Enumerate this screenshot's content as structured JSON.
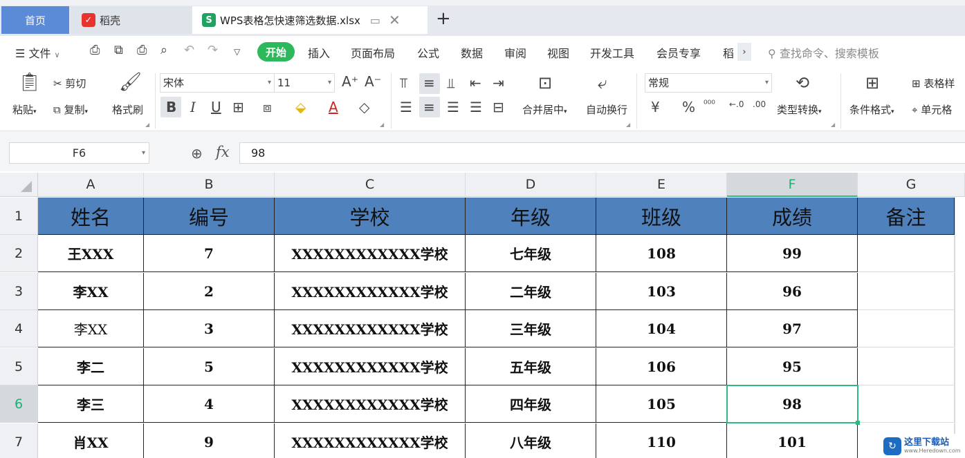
{
  "tabs": {
    "home": "首页",
    "daoke": "稻壳",
    "file": "WPS表格怎快速筛选数据.xlsx",
    "plus": "+"
  },
  "menu": {
    "file": "文件",
    "items": [
      "开始",
      "插入",
      "页面布局",
      "公式",
      "数据",
      "审阅",
      "视图",
      "开发工具",
      "会员专享",
      "稻"
    ],
    "search": "查找命令、搜索模板"
  },
  "ribbon": {
    "paste": "粘贴",
    "cut": "剪切",
    "copy": "复制",
    "format_painter": "格式刷",
    "font_name": "宋体",
    "font_size": "11",
    "merge_center": "合并居中",
    "wrap_text": "自动换行",
    "number_format": "常规",
    "type_convert": "类型转换",
    "cond_format": "条件格式",
    "table_style": "表格样",
    "cell_style": "单元格"
  },
  "formula_bar": {
    "name_box": "F6",
    "fx": "fx",
    "value": "98"
  },
  "sheet": {
    "columns": [
      "A",
      "B",
      "C",
      "D",
      "E",
      "F",
      "G"
    ],
    "rows": [
      "1",
      "2",
      "3",
      "4",
      "5",
      "6",
      "7"
    ],
    "header": [
      "姓名",
      "编号",
      "学校",
      "年级",
      "班级",
      "成绩",
      "备注"
    ],
    "data": [
      [
        "王XXX",
        "7",
        "XXXXXXXXXXXX学校",
        "七年级",
        "108",
        "99",
        ""
      ],
      [
        "李XX",
        "2",
        "XXXXXXXXXXXX学校",
        "二年级",
        "103",
        "96",
        ""
      ],
      [
        "李XX",
        "3",
        "XXXXXXXXXXXX学校",
        "三年级",
        "104",
        "97",
        ""
      ],
      [
        "李二",
        "5",
        "XXXXXXXXXXXX学校",
        "五年级",
        "106",
        "95",
        ""
      ],
      [
        "李三",
        "4",
        "XXXXXXXXXXXX学校",
        "四年级",
        "105",
        "98",
        ""
      ],
      [
        "肖XX",
        "9",
        "XXXXXXXXXXXX学校",
        "八年级",
        "110",
        "101",
        ""
      ]
    ],
    "selected_cell": "F6"
  },
  "watermark": {
    "title": "这里下载站",
    "url": "www.Heredown.com"
  },
  "colors": {
    "accent_green": "#2eb85c",
    "header_fill": "#4f81bd",
    "selection": "#2db97f"
  }
}
